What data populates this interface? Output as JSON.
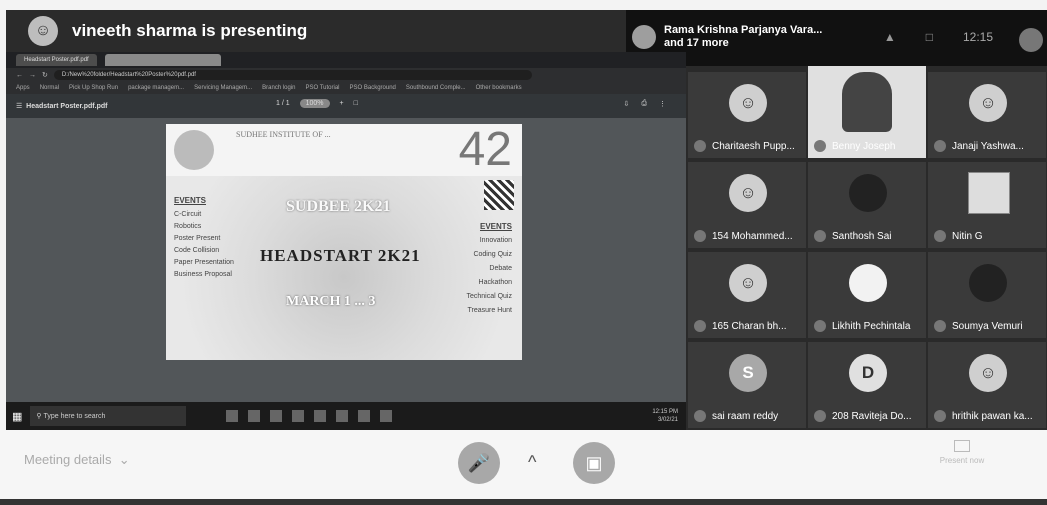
{
  "presenter": {
    "text": "vineeth sharma is presenting"
  },
  "others": {
    "line1": "Rama Krishna Parjanya Vara...",
    "line2": "and 17 more"
  },
  "top_right": {
    "clock": "12:15"
  },
  "browser": {
    "tabs": [
      "Headstart Poster.pdf.pdf",
      ""
    ],
    "url": "D:/New%20folder/Headstart%20Poster%20pdf.pdf",
    "bookmarks": [
      "Apps",
      "Normal",
      "Pick Up Shop Run",
      "package managem...",
      "Servicing Managem...",
      "Branch login",
      "PSO Tutorial",
      "PSO Background",
      "Southbound Comple...",
      "Other bookmarks"
    ]
  },
  "pdf": {
    "title": "Headstart Poster.pdf.pdf",
    "page": "1 / 1",
    "zoom": "100%"
  },
  "poster": {
    "school_name": "SUDHEE INSTITUTE OF ...",
    "number": "42",
    "events_left_heading": "EVENTS",
    "events_left": [
      "C-Circuit",
      "Robotics",
      "Poster Present",
      "Code Collision",
      "Paper Presentation",
      "Business Proposal"
    ],
    "title1": "SUDBEE 2K21",
    "title2": "HEADSTART 2K21",
    "title3": "MARCH 1 ... 3",
    "events_right_heading": "EVENTS",
    "events_right": [
      "Innovation",
      "Coding Quiz",
      "Debate",
      "Hackathon",
      "Technical Quiz",
      "Treasure Hunt"
    ]
  },
  "taskbar": {
    "search_placeholder": "Type here to search",
    "time": "12:15 PM",
    "date": "3/02/21"
  },
  "tiles": [
    {
      "name": "Charitaesh Pupp...",
      "kind": "avatar"
    },
    {
      "name": "Benny Joseph",
      "kind": "video"
    },
    {
      "name": "Janaji Yashwa...",
      "kind": "avatar"
    },
    {
      "name": "154 Mohammed...",
      "kind": "avatar"
    },
    {
      "name": "Santhosh Sai",
      "kind": "dark"
    },
    {
      "name": "Nitin G",
      "kind": "square"
    },
    {
      "name": "165 Charan bh...",
      "kind": "avatar"
    },
    {
      "name": "Likhith Pechintala",
      "kind": "avatar"
    },
    {
      "name": "Soumya Vemuri",
      "kind": "dark"
    },
    {
      "name": "sai raam reddy",
      "kind": "letter",
      "letter": "S"
    },
    {
      "name": "208 Raviteja Do...",
      "kind": "letter",
      "letter": "D"
    },
    {
      "name": "hrithik pawan ka...",
      "kind": "avatar"
    }
  ],
  "bottom": {
    "meeting_details": "Meeting details",
    "chevron": "^",
    "present_label": "Present now"
  },
  "icons": {
    "mic": "mic-off-icon",
    "cam": "camera-off-icon"
  }
}
